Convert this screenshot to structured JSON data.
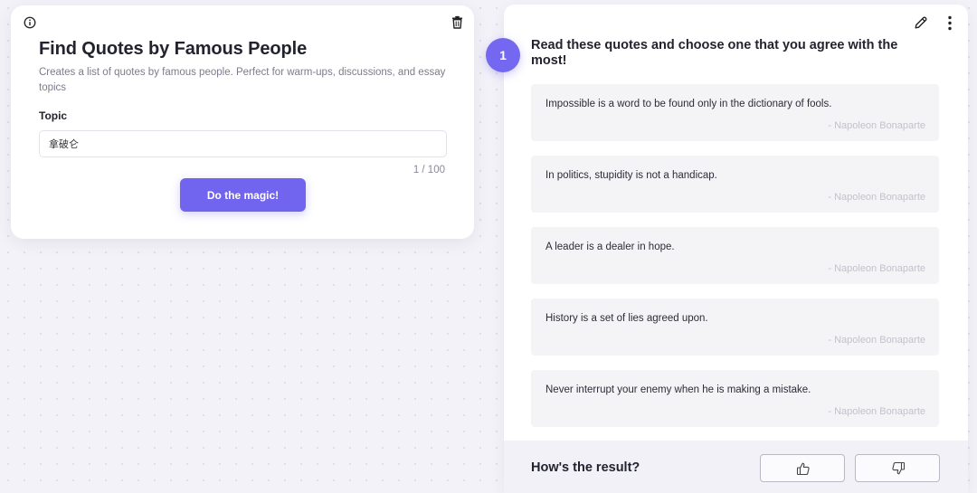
{
  "tool": {
    "title": "Find Quotes by Famous People",
    "description": "Creates a list of quotes by famous people. Perfect for warm-ups, discussions, and essay topics",
    "topic_label": "Topic",
    "topic_value": "拿破仑",
    "char_count": "1 / 100",
    "submit_label": "Do the magic!"
  },
  "result": {
    "step_number": "1",
    "step_title": "Read these quotes and choose one that you agree with the most!",
    "quotes": [
      {
        "text": "Impossible is a word to be found only in the dictionary of fools.",
        "author": "- Napoleon Bonaparte"
      },
      {
        "text": "In politics, stupidity is not a handicap.",
        "author": "- Napoleon Bonaparte"
      },
      {
        "text": "A leader is a dealer in hope.",
        "author": "- Napoleon Bonaparte"
      },
      {
        "text": "History is a set of lies agreed upon.",
        "author": "- Napoleon Bonaparte"
      },
      {
        "text": "Never interrupt your enemy when he is making a mistake.",
        "author": "- Napoleon Bonaparte"
      }
    ],
    "feedback_label": "How's the result?"
  },
  "icons": {
    "info": "info-icon",
    "trash": "trash-icon",
    "edit": "pencil-icon",
    "more": "more-vertical-icon",
    "like": "thumbs-up-icon",
    "dislike": "thumbs-down-icon"
  },
  "colors": {
    "accent": "#7165f0",
    "page_background": "#f3f2f8",
    "quote_card": "#f4f4f6",
    "feedback_bar": "#f1f1f7"
  }
}
